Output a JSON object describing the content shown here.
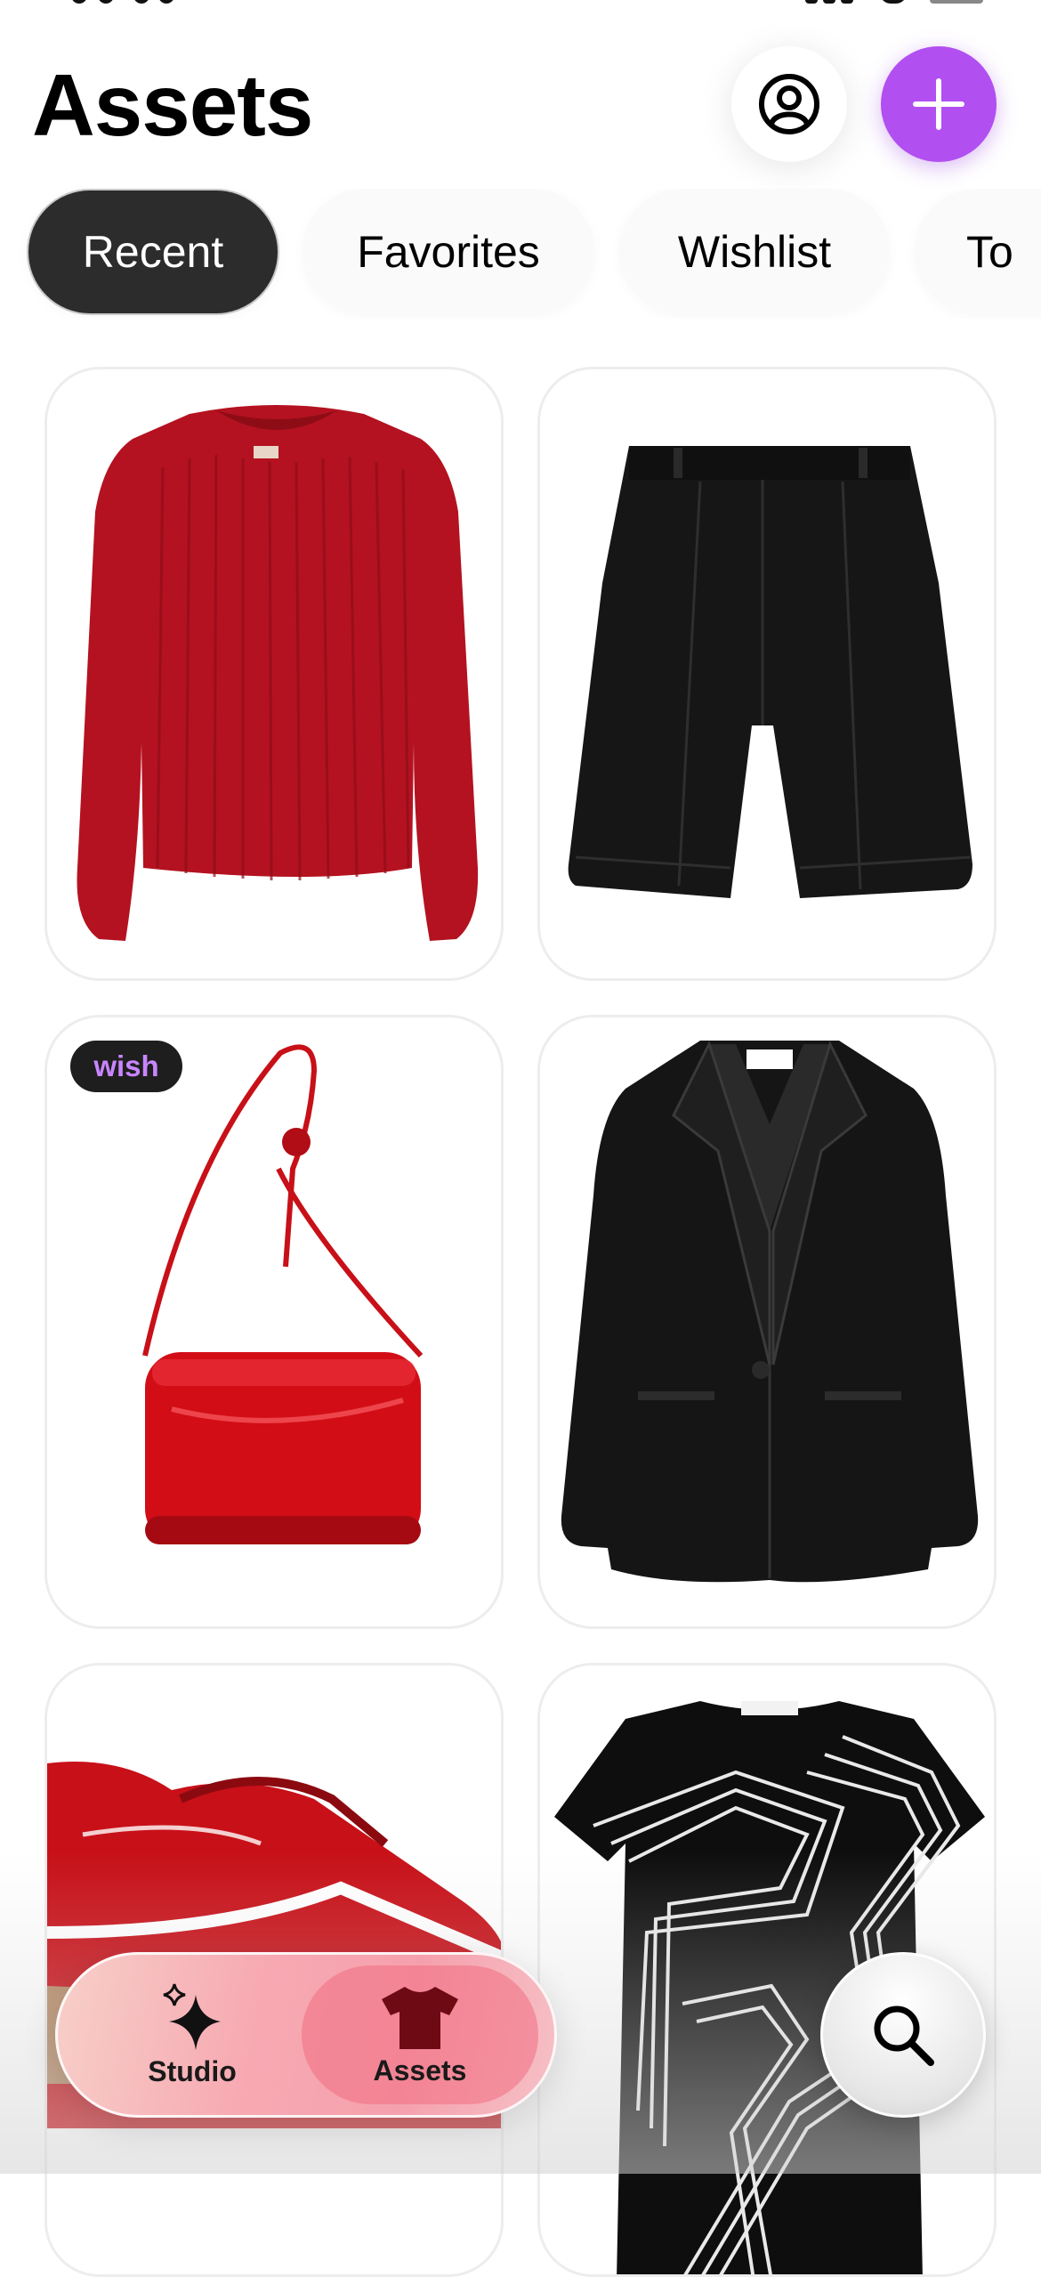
{
  "header": {
    "title": "Assets"
  },
  "tabs": [
    {
      "label": "Recent",
      "active": true
    },
    {
      "label": "Favorites",
      "active": false
    },
    {
      "label": "Wishlist",
      "active": false
    },
    {
      "label": "To",
      "active": false
    }
  ],
  "items": [
    {
      "name": "red-sweater",
      "badge": ""
    },
    {
      "name": "black-shorts",
      "badge": ""
    },
    {
      "name": "red-bag",
      "badge": "wish"
    },
    {
      "name": "leather-blazer",
      "badge": ""
    },
    {
      "name": "red-sneakers",
      "badge": ""
    },
    {
      "name": "printed-dress",
      "badge": ""
    }
  ],
  "tabbar": {
    "items": [
      {
        "label": "Studio",
        "icon": "sparkles-icon",
        "active": false
      },
      {
        "label": "Assets",
        "icon": "tshirt-icon",
        "active": true
      }
    ]
  },
  "colors": {
    "accent": "#b14ff0",
    "tab_active": "#2c2c2c",
    "badge_text": "#c985ff"
  }
}
